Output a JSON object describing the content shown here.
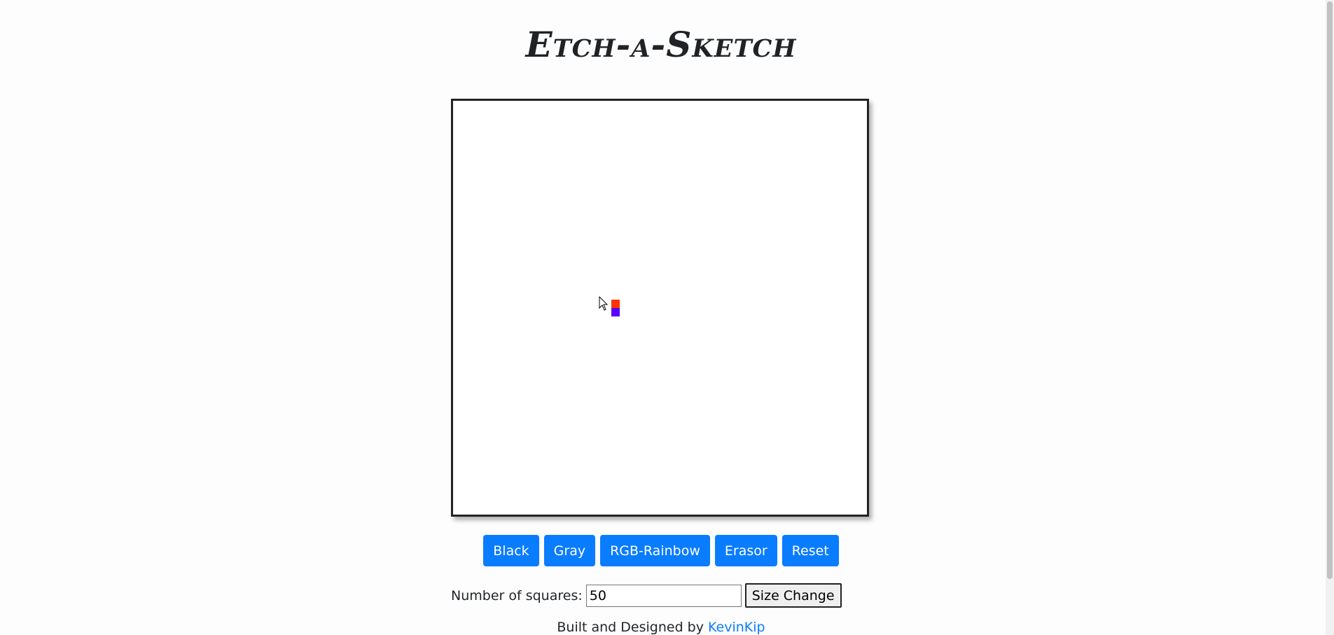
{
  "page": {
    "title": "Etch-a-Sketch"
  },
  "board": {
    "painted_cells": [
      {
        "color": "#ff3300"
      },
      {
        "color": "#5500ff"
      }
    ]
  },
  "toolbar": {
    "black_label": "Black",
    "gray_label": "Gray",
    "rainbow_label": "RGB-Rainbow",
    "eraser_label": "Erasor",
    "reset_label": "Reset"
  },
  "size_control": {
    "label": "Number of squares:",
    "value": "50",
    "button_label": "Size Change"
  },
  "footer": {
    "text": "Built and Designed by",
    "author_link": "KevinKip"
  },
  "colors": {
    "accent": "#0a7cff",
    "board_border": "#222222"
  }
}
